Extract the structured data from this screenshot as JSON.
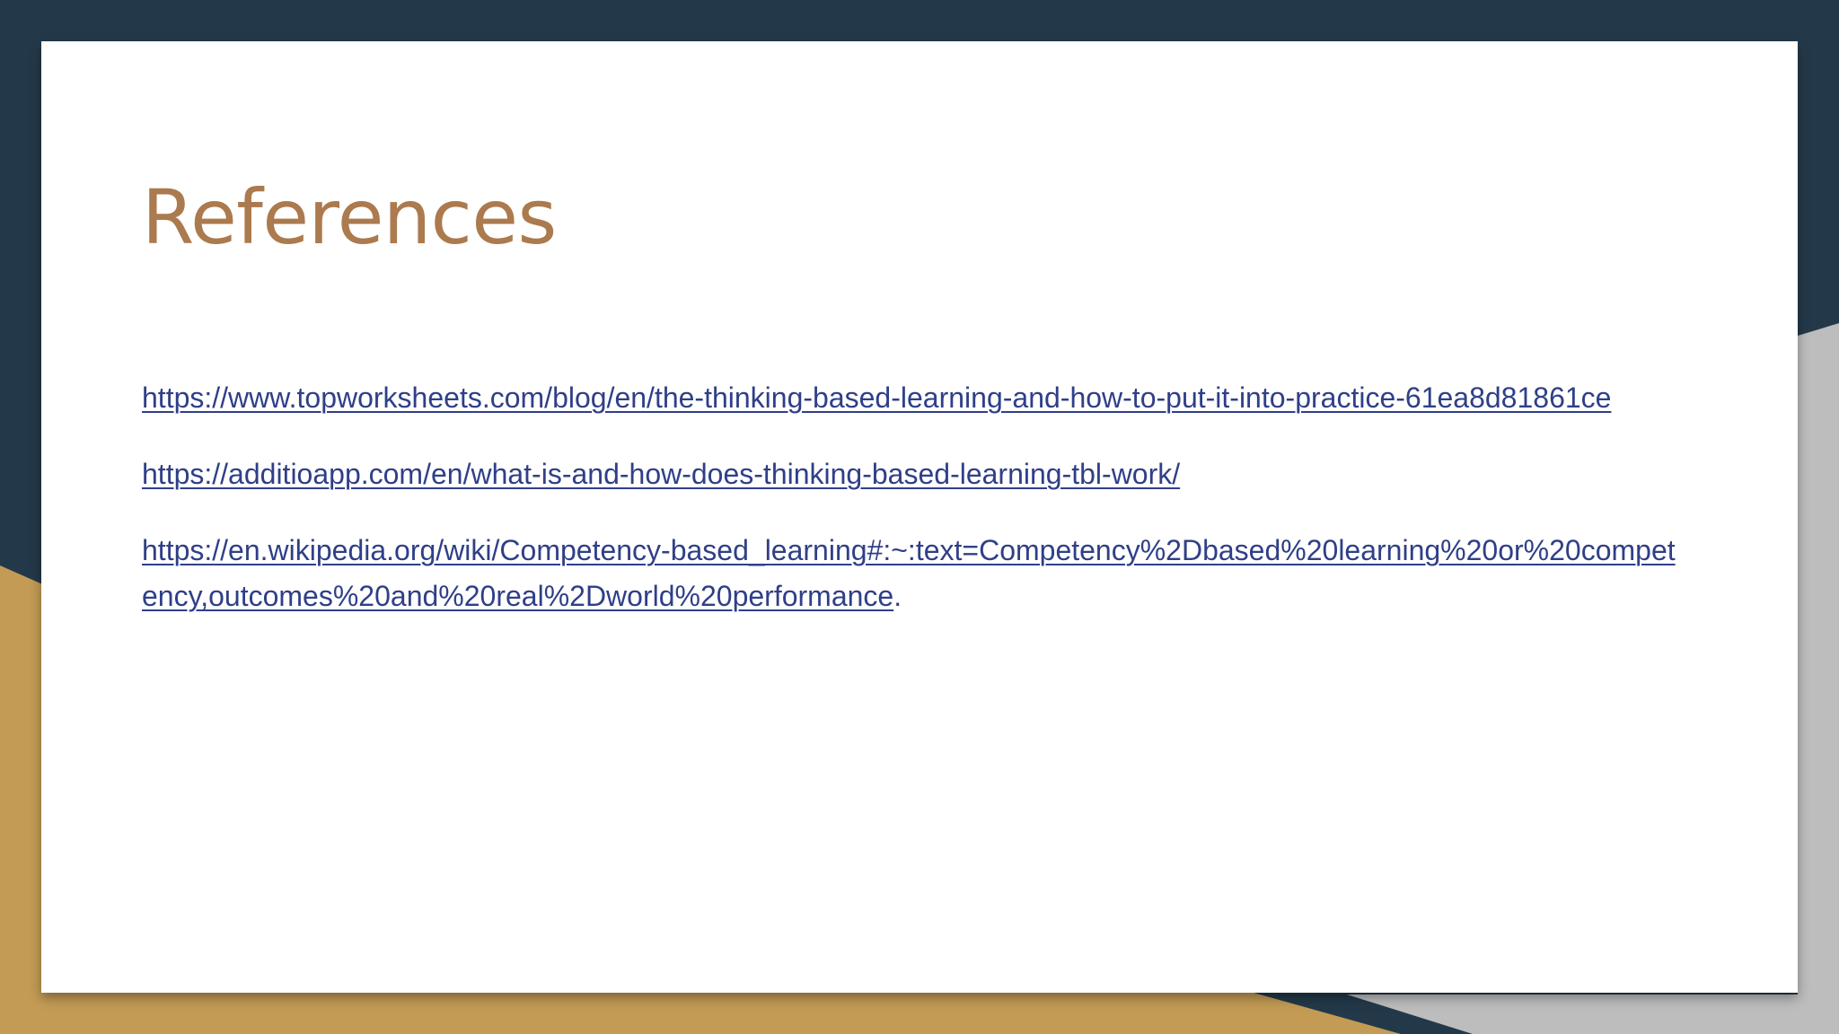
{
  "slide": {
    "title": "References",
    "references": [
      {
        "url": "https://www.topworksheets.com/blog/en/the-thinking-based-learning-and-how-to-put-it-into-practice-61ea8d81861ce",
        "suffix": ""
      },
      {
        "url": "https://additioapp.com/en/what-is-and-how-does-thinking-based-learning-tbl-work/",
        "suffix": ""
      },
      {
        "url": "https://en.wikipedia.org/wiki/Competency-based_learning#:~:text=Competency%2Dbased%20learning%20or%20competency,outcomes%20and%20real%2Dworld%20performance",
        "suffix": "."
      }
    ]
  },
  "colors": {
    "title": "#ab7a4e",
    "link": "#2f3f88",
    "background_dark": "#23394a",
    "background_gold": "#c39b55",
    "background_gray": "#bdbdbd"
  }
}
